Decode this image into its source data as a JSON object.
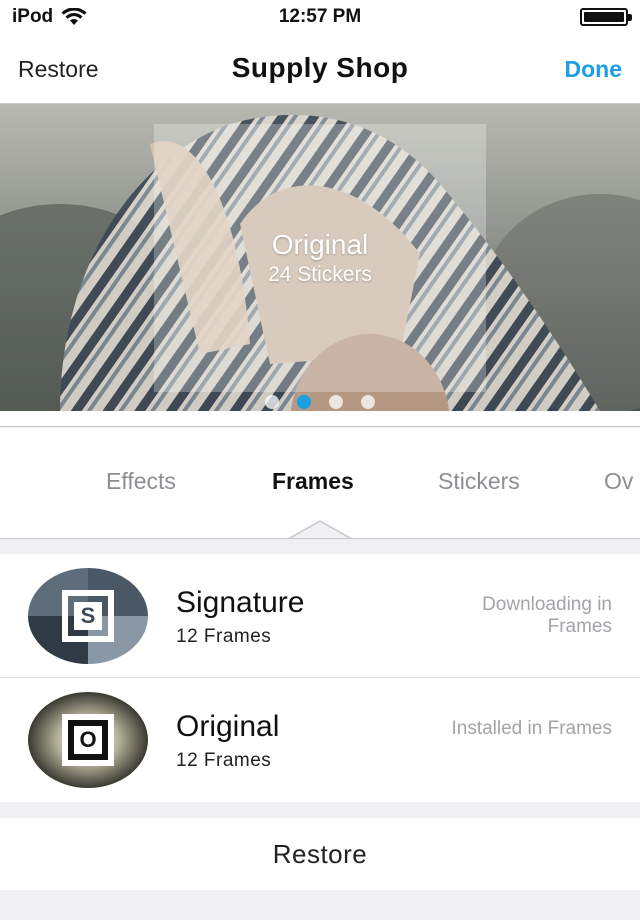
{
  "status_bar": {
    "carrier": "iPod",
    "time": "12:57 PM",
    "battery_level": 1.0,
    "icons": [
      "wifi-icon",
      "battery-icon"
    ]
  },
  "nav": {
    "left_label": "Restore",
    "title": "Supply Shop",
    "right_label": "Done",
    "accent_color": "#1a9fe0"
  },
  "banner": {
    "title": "Original",
    "subtitle": "24 Stickers",
    "page_count": 4,
    "active_page": 2
  },
  "tabs": [
    {
      "label": "Effects",
      "active": false
    },
    {
      "label": "Frames",
      "active": true
    },
    {
      "label": "Stickers",
      "active": false
    },
    {
      "label": "Ov",
      "active": false
    }
  ],
  "items": [
    {
      "title": "Signature",
      "subtitle": "12 Frames",
      "status": "Downloading in Frames",
      "thumb_letter": "S"
    },
    {
      "title": "Original",
      "subtitle": "12 Frames",
      "status": "Installed in Frames",
      "thumb_letter": "O"
    }
  ],
  "footer": {
    "restore_label": "Restore"
  }
}
